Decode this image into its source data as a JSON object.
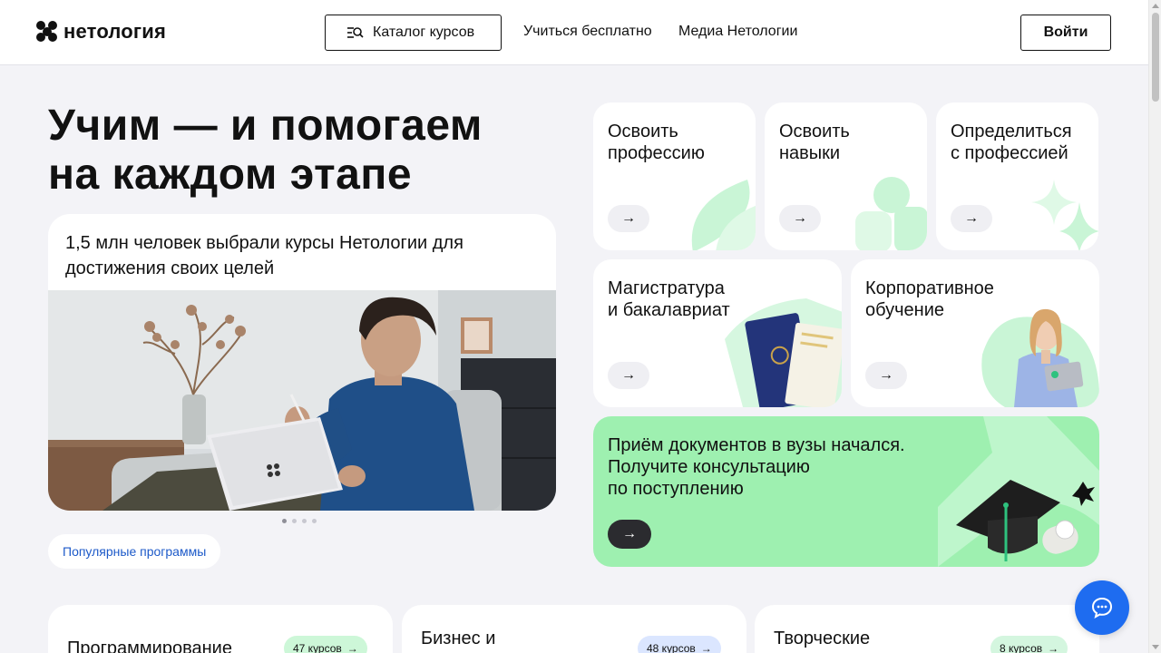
{
  "header": {
    "logo_text": "нетология",
    "catalog_label": "Каталог курсов",
    "nav": [
      "Учиться бесплатно",
      "Медиа Нетологии"
    ],
    "login_label": "Войти"
  },
  "hero": {
    "title_line1": "Учим — и помогаем",
    "title_line2": "на каждом этапе",
    "card_text": "1,5 млн человек выбрали курсы Нетологии для достижения своих целей",
    "popular_label": "Популярные программы"
  },
  "tiles": {
    "profession": {
      "line1": "Освоить",
      "line2": "профессию"
    },
    "skills": {
      "line1": "Освоить",
      "line2": "навыки"
    },
    "define": {
      "line1": "Определиться",
      "line2": "с профессией"
    },
    "magistr": {
      "line1": "Магистратура",
      "line2": "и бакалавриат"
    },
    "corporate": {
      "line1": "Корпоративное",
      "line2": "обучение"
    },
    "admission": {
      "line1": "Приём документов в вузы начался.",
      "line2": "Получите консультацию",
      "line3": "по поступлению"
    },
    "arrow": "→"
  },
  "categories": [
    {
      "title": "Программирование",
      "badge": "47 курсов",
      "badge_color": "#cdf7d8"
    },
    {
      "title": "Бизнес и",
      "badge": "48 курсов",
      "badge_color": "#dbe6ff"
    },
    {
      "title": "Творческие",
      "badge": "8 курсов",
      "badge_color": "#d4f6df"
    }
  ],
  "colors": {
    "accent_green": "#9ef0b0",
    "chat_blue": "#1e6cf0",
    "link_blue": "#1d5ac9"
  }
}
